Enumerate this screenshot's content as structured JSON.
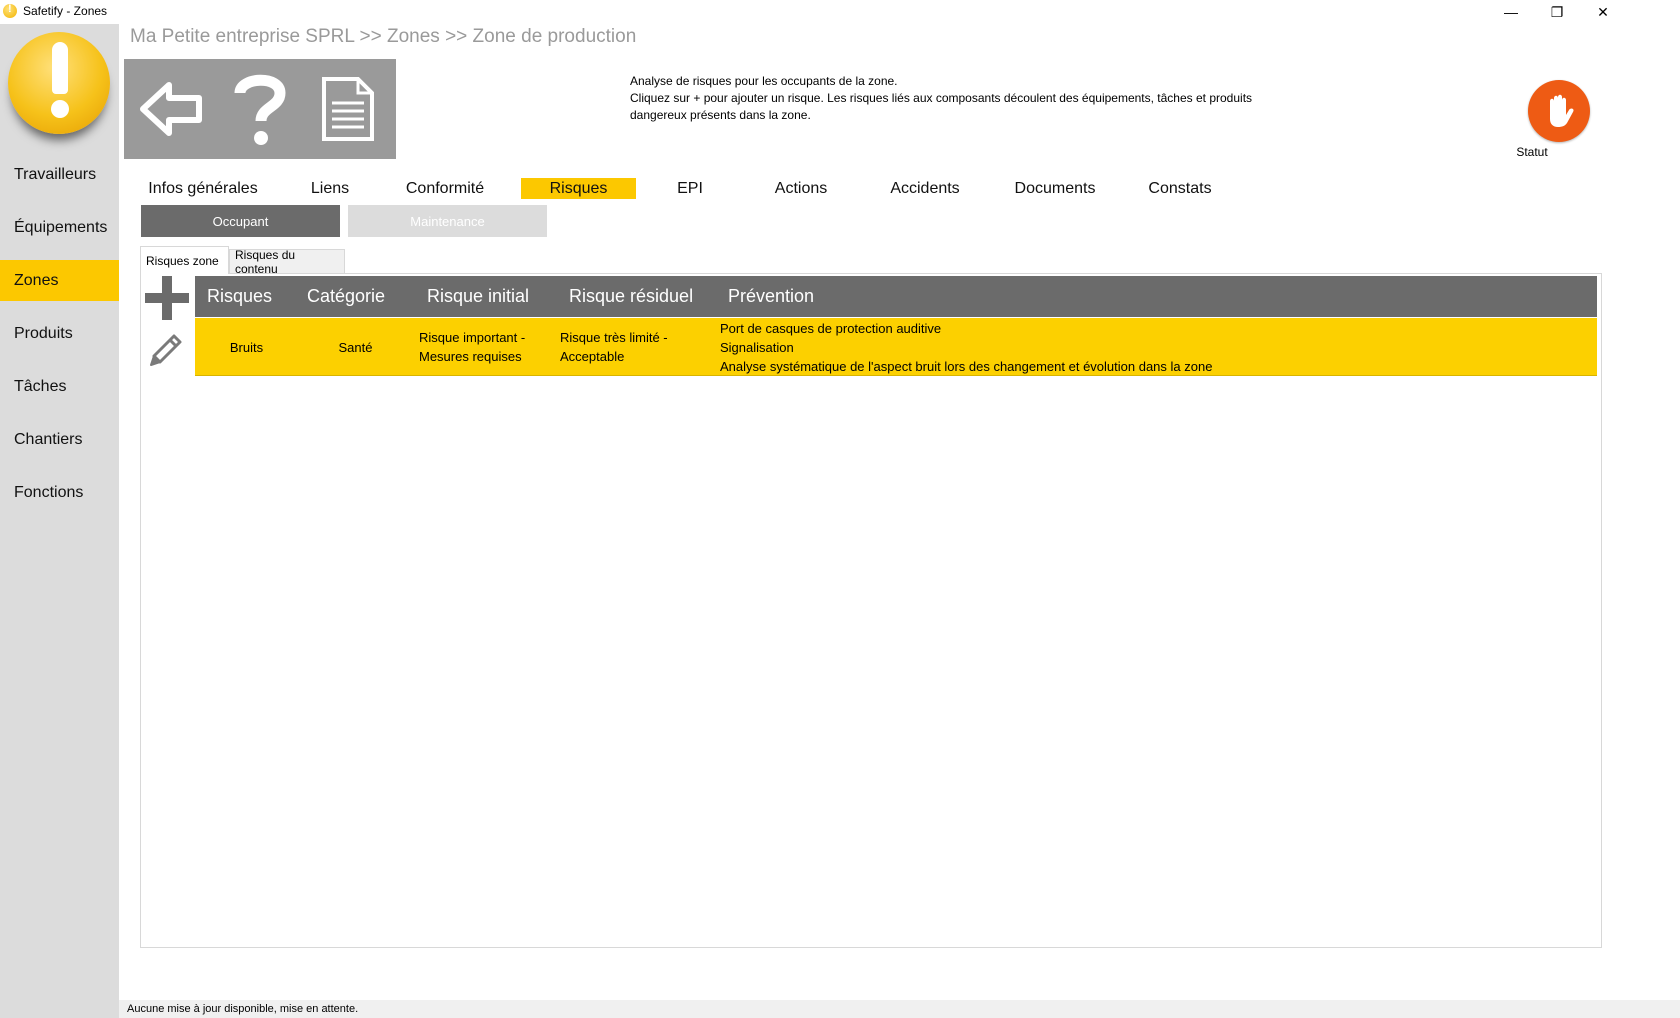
{
  "window": {
    "title": "Safetify - Zones",
    "minimize_glyph": "—",
    "restore_glyph": "❐",
    "close_glyph": "✕"
  },
  "sidebar": {
    "logo": "safetify-logo",
    "items": [
      {
        "label": "Travailleurs",
        "active": false
      },
      {
        "label": "Équipements",
        "active": false
      },
      {
        "label": "Zones",
        "active": true
      },
      {
        "label": "Produits",
        "active": false
      },
      {
        "label": "Tâches",
        "active": false
      },
      {
        "label": "Chantiers",
        "active": false
      },
      {
        "label": "Fonctions",
        "active": false
      }
    ]
  },
  "breadcrumb": "Ma Petite entreprise SPRL >> Zones >> Zone de production",
  "toolbar": {
    "buttons": [
      {
        "icon": "back-arrow-icon"
      },
      {
        "icon": "help-icon"
      },
      {
        "icon": "document-icon"
      }
    ]
  },
  "description": {
    "line1": "Analyse de risques pour les occupants de la zone.",
    "line2": "Cliquez sur + pour ajouter un risque. Les risques liés aux composants découlent des équipements, tâches et produits dangereux présents dans la zone."
  },
  "status": {
    "label": "Statut",
    "icon": "hand-stop-icon",
    "color": "#ee5b14"
  },
  "tabs": [
    {
      "label": "Infos générales"
    },
    {
      "label": "Liens"
    },
    {
      "label": "Conformité"
    },
    {
      "label": "Risques",
      "active": true
    },
    {
      "label": "EPI"
    },
    {
      "label": "Actions"
    },
    {
      "label": "Accidents"
    },
    {
      "label": "Documents"
    },
    {
      "label": "Constats"
    }
  ],
  "subtabs": {
    "occupant": "Occupant",
    "maintenance": "Maintenance"
  },
  "inner_tabs": {
    "zone": "Risques zone",
    "contenu": "Risques du contenu"
  },
  "grid": {
    "columns": [
      "Risques",
      "Catégorie",
      "Risque initial",
      "Risque résiduel",
      "Prévention"
    ],
    "rows": [
      {
        "risque": "Bruits",
        "categorie": "Santé",
        "initial_1": "Risque important -",
        "initial_2": "Mesures requises",
        "residuel_1": "Risque très limité -",
        "residuel_2": "Acceptable",
        "prevention_1": "Port de casques de protection auditive",
        "prevention_2": "Signalisation",
        "prevention_3": "Analyse systématique de l'aspect bruit lors des changement et évolution dans la zone"
      }
    ]
  },
  "colors": {
    "accent": "#fcc800",
    "header": "#6b6b6b",
    "sidebar": "#dcdcdc"
  },
  "statusbar": "Aucune mise à jour disponible, mise en attente."
}
